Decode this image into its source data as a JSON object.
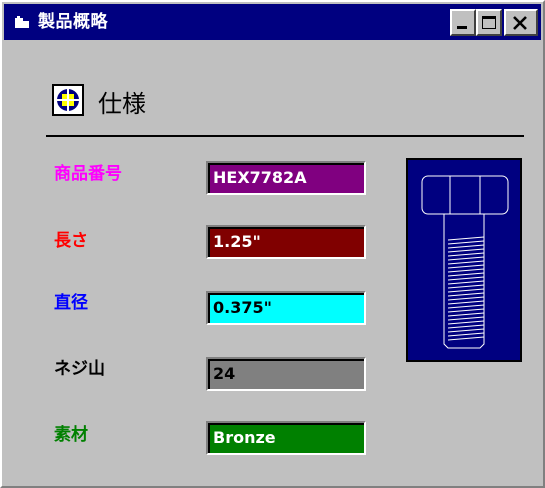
{
  "window": {
    "title": "製品概略"
  },
  "header": {
    "title": "仕様",
    "icon": "target-square-icon"
  },
  "fields": [
    {
      "label": "商品番号",
      "value": "HEX7782A",
      "label_color": "#ff00ff",
      "bg": "#800080",
      "fg": "#ffffff"
    },
    {
      "label": "長さ",
      "value": "1.25\"",
      "label_color": "#ff0000",
      "bg": "#800000",
      "fg": "#ffffff"
    },
    {
      "label": "直径",
      "value": "0.375\"",
      "label_color": "#0000ff",
      "bg": "#00ffff",
      "fg": "#000000"
    },
    {
      "label": "ネジ山",
      "value": "24",
      "label_color": "#000000",
      "bg": "#808080",
      "fg": "#000000"
    },
    {
      "label": "素材",
      "value": "Bronze",
      "label_color": "#008000",
      "bg": "#008000",
      "fg": "#ffffff"
    }
  ],
  "image": {
    "icon": "hex-bolt-icon"
  }
}
